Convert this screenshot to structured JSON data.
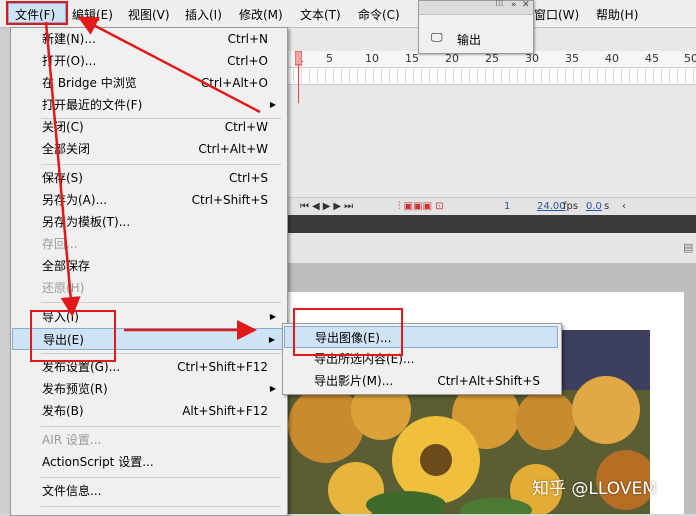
{
  "menubar": {
    "items": [
      "文件(F)",
      "编辑(E)",
      "视图(V)",
      "插入(I)",
      "修改(M)",
      "文本(T)",
      "命令(C)",
      "窗口(W)",
      "帮助(H)"
    ]
  },
  "output_panel": {
    "label": "输出"
  },
  "timeline": {
    "ticks": [
      "1",
      "5",
      "10",
      "15",
      "20",
      "25",
      "30",
      "35",
      "40",
      "45",
      "50"
    ],
    "frame": "1",
    "fps": "24.00",
    "fps_unit": "fps",
    "time": "0.0",
    "time_unit": "s"
  },
  "file_menu": {
    "items": [
      {
        "label": "新建(N)...",
        "shortcut": "Ctrl+N"
      },
      {
        "label": "打开(O)...",
        "shortcut": "Ctrl+O"
      },
      {
        "label": "在 Bridge 中浏览",
        "shortcut": "Ctrl+Alt+O"
      },
      {
        "label": "打开最近的文件(F)",
        "shortcut": ""
      },
      {
        "label": "关闭(C)",
        "shortcut": "Ctrl+W"
      },
      {
        "label": "全部关闭",
        "shortcut": "Ctrl+Alt+W"
      },
      {
        "label": "保存(S)",
        "shortcut": "Ctrl+S"
      },
      {
        "label": "另存为(A)...",
        "shortcut": "Ctrl+Shift+S"
      },
      {
        "label": "另存为模板(T)...",
        "shortcut": ""
      },
      {
        "label": "存回...",
        "shortcut": ""
      },
      {
        "label": "全部保存",
        "shortcut": ""
      },
      {
        "label": "还原(H)",
        "shortcut": ""
      },
      {
        "label": "导入(I)",
        "shortcut": ""
      },
      {
        "label": "导出(E)",
        "shortcut": ""
      },
      {
        "label": "发布设置(G)...",
        "shortcut": "Ctrl+Shift+F12"
      },
      {
        "label": "发布预览(R)",
        "shortcut": ""
      },
      {
        "label": "发布(B)",
        "shortcut": "Alt+Shift+F12"
      },
      {
        "label": "AIR 设置...",
        "shortcut": ""
      },
      {
        "label": "ActionScript 设置...",
        "shortcut": ""
      },
      {
        "label": "文件信息...",
        "shortcut": ""
      }
    ]
  },
  "export_submenu": {
    "items": [
      {
        "label": "导出图像(E)...",
        "shortcut": ""
      },
      {
        "label": "导出所选内容(E)...",
        "shortcut": ""
      },
      {
        "label": "导出影片(M)...",
        "shortcut": "Ctrl+Alt+Shift+S"
      }
    ]
  },
  "watermark": "知乎 @LLOVEM",
  "colors": {
    "annotation_red": "#e11919",
    "menu_highlight": "#cfe3f7",
    "playhead": "#e84646"
  }
}
